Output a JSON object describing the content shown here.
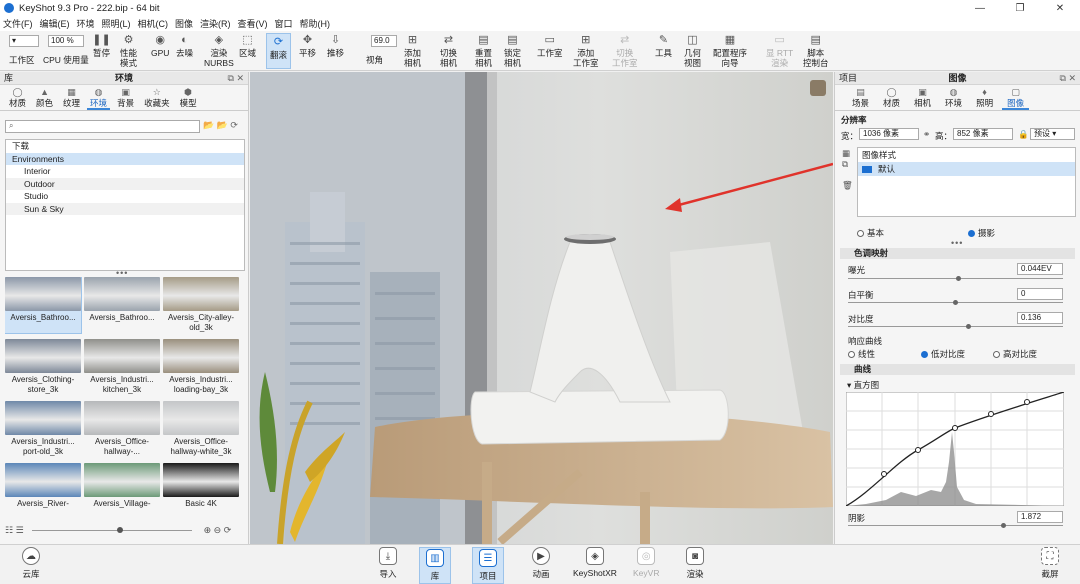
{
  "window": {
    "title": "KeyShot 9.3 Pro  - 222.bip  - 64 bit",
    "controls": [
      "—",
      "❐",
      "✕"
    ]
  },
  "menu": [
    "文件(F)",
    "编辑(E)",
    "环境",
    "照明(L)",
    "相机(C)",
    "图像",
    "渲染(R)",
    "查看(V)",
    "窗口",
    "帮助(H)"
  ],
  "toolbar": {
    "workspace_label": "工作区",
    "cpu_label": "CPU 使用量",
    "zoom_value": "100 %",
    "pause_label": "暂停",
    "perf_label": "性能\n模式",
    "gpu_label": "GPU",
    "denoise_label": "去噪",
    "nurbs_label": "渲染\nNURBS",
    "region_label": "区域",
    "tumble_label": "翻滚",
    "pan_label": "平移",
    "dolly_label": "推移",
    "fov_value": "69.0",
    "fov_label": "视角",
    "add_camera_label": "添加\n相机",
    "switch_camera_label": "切换\n相机",
    "reset_camera_label": "重置\n相机",
    "lock_camera_label": "锁定\n相机",
    "studio_label": "工作室",
    "add_studio_label": "添加\n工作室",
    "switch_studio_label": "切换\n工作室",
    "tools_label": "工具",
    "geometry_label": "几何\n视图",
    "config_label": "配置程序\n向导",
    "render_label": "显 RTT\n渲染",
    "script_label": "脚本\n控制台"
  },
  "library": {
    "header_left": "库",
    "header_title": "环境",
    "header_icons": "⧉ ✕",
    "tabs": [
      {
        "icon": "◯",
        "label": "材质"
      },
      {
        "icon": "▲",
        "label": "颜色"
      },
      {
        "icon": "▦",
        "label": "纹理"
      },
      {
        "icon": "◍",
        "label": "环境"
      },
      {
        "icon": "▣",
        "label": "背景"
      },
      {
        "icon": "☆",
        "label": "收藏夹"
      },
      {
        "icon": "⬢",
        "label": "模型"
      }
    ],
    "search_placeholder": "⌕",
    "search_tools": "📂 📂 ⟳",
    "tree": [
      "下载",
      "Environments",
      "Interior",
      "Outdoor",
      "Studio",
      "Sun & Sky"
    ],
    "thumbnails": [
      {
        "label": "Aversis_Bathroo...",
        "color": "#8b97a8"
      },
      {
        "label": "Aversis_Bathroo...",
        "color": "#9aa3ad"
      },
      {
        "label": "Aversis_City-alley-old_3k",
        "color": "#a59b86"
      },
      {
        "label": "Aversis_Clothing-store_3k",
        "color": "#7d8898"
      },
      {
        "label": "Aversis_Industri... kitchen_3k",
        "color": "#8f8f8a"
      },
      {
        "label": "Aversis_Industri... loading-bay_3k",
        "color": "#9a8f7d"
      },
      {
        "label": "Aversis_Industri... port-old_3k",
        "color": "#6f88a8"
      },
      {
        "label": "Aversis_Office-hallway-...",
        "color": "#b6b8ba"
      },
      {
        "label": "Aversis_Office-hallway-white_3k",
        "color": "#c4c6c8"
      },
      {
        "label": "Aversis_River-",
        "color": "#5b86b8"
      },
      {
        "label": "Aversis_Village-",
        "color": "#6c9a78"
      },
      {
        "label": "Basic 4K",
        "color": "#1a1a1a"
      }
    ],
    "handle": "•••"
  },
  "properties": {
    "header_left": "项目",
    "header_title": "图像",
    "header_icons": "⧉ ✕",
    "tabs": [
      {
        "icon": "▤",
        "label": "场景"
      },
      {
        "icon": "◯",
        "label": "材质"
      },
      {
        "icon": "▣",
        "label": "相机"
      },
      {
        "icon": "◍",
        "label": "环境"
      },
      {
        "icon": "♦",
        "label": "照明"
      },
      {
        "icon": "▢",
        "label": "图像"
      }
    ],
    "resolution_title": "分辨率",
    "width_label": "宽：",
    "width_value": "1036 像素",
    "height_label": "高：",
    "height_value": "852 像素",
    "preset_value": "预设",
    "image_style_title": "图像样式",
    "default_style": "默认",
    "mode_basic": "基本",
    "mode_photo": "摄影",
    "tone_section": "色调映射",
    "exposure_label": "曝光",
    "exposure_value": "0.044EV",
    "white_balance_label": "白平衡",
    "white_balance_value": "0",
    "contrast_label": "对比度",
    "contrast_value": "0.136",
    "response_label": "响应曲线",
    "response_linear": "线性",
    "response_low": "低对比度",
    "response_high": "高对比度",
    "curves_section": "曲线",
    "histogram_label": "直方图",
    "shadow_label": "阴影",
    "shadow_value": "1.872",
    "handle": "•••"
  },
  "statusbar": {
    "cloud": "云库",
    "import": "导入",
    "library": "库",
    "project": "项目",
    "animation": "动画",
    "keyshotxr": "KeyShotXR",
    "keyvr": "KeyVR",
    "render": "渲染",
    "screenshot": "截屏"
  }
}
